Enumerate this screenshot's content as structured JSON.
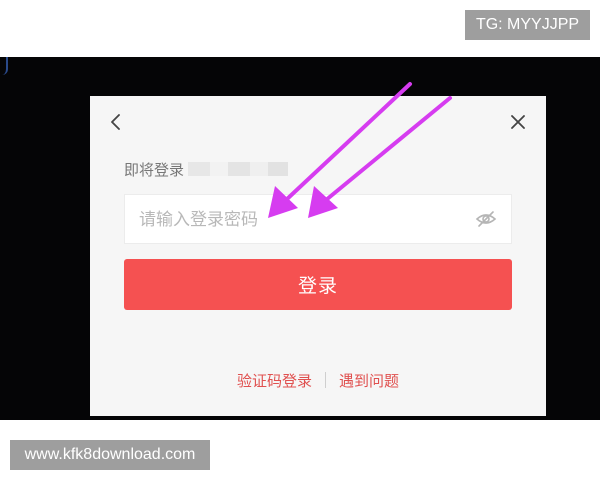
{
  "watermark_top": "TG: MYYJJPP",
  "watermark_bottom": "www.kfk8download.com",
  "dialog": {
    "back_icon": "chevron-left-icon",
    "close_icon": "close-icon",
    "account_label": "即将登录",
    "password": {
      "value": "",
      "placeholder": "请输入登录密码",
      "visibility_icon": "eye-off-icon"
    },
    "login_button": "登录",
    "links": {
      "sms_login": "验证码登录",
      "help": "遇到问题"
    }
  },
  "colors": {
    "accent": "#f55151",
    "link": "#e0504f",
    "annotation_arrow": "#d63cf0",
    "background": "#050506",
    "dialog": "#f6f6f6"
  }
}
